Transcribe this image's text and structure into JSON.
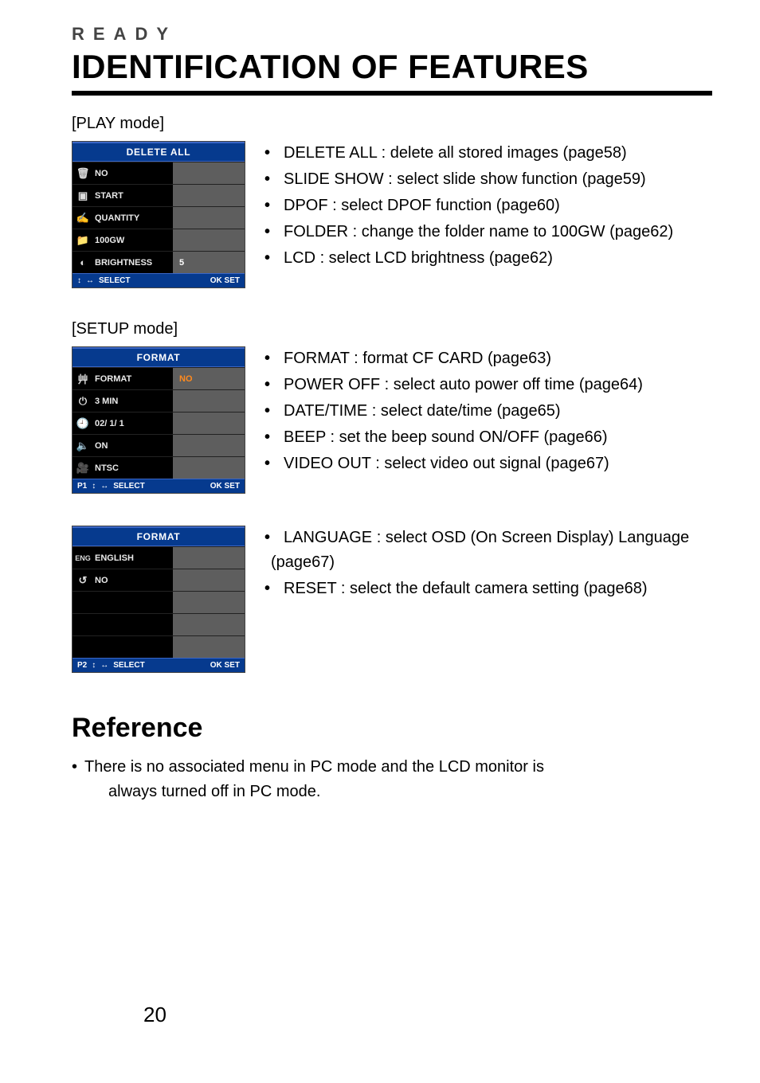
{
  "header": {
    "kicker": "READY",
    "title": "IDENTIFICATION OF FEATURES"
  },
  "play_mode": {
    "label": "[PLAY mode]",
    "osd": {
      "title": "DELETE  ALL",
      "rows": [
        {
          "icon": "trash-icon",
          "glyph": "🗑",
          "label": "NO",
          "value": ""
        },
        {
          "icon": "slideshow-icon",
          "glyph": "▣",
          "label": "START",
          "value": ""
        },
        {
          "icon": "dpof-icon",
          "glyph": "✍",
          "label": "QUANTITY",
          "value": ""
        },
        {
          "icon": "folder-icon",
          "glyph": "📁",
          "label": "100GW",
          "value": ""
        },
        {
          "icon": "brightness-icon",
          "glyph": "◐",
          "label": "BRIGHTNESS",
          "value": "5"
        }
      ],
      "footer_left": "SELECT",
      "footer_page": "",
      "footer_right": "OK  SET"
    },
    "desc": [
      "DELETE ALL : delete all stored images (page58)",
      "SLIDE SHOW : select slide show function (page59)",
      "DPOF : select DPOF function (page60)",
      "FOLDER : change the folder name to 100GW (page62)",
      "LCD : select LCD brightness (page62)"
    ]
  },
  "setup_mode": {
    "label": "[SETUP mode]",
    "osd1": {
      "title": "FORMAT",
      "rows": [
        {
          "icon": "format-icon",
          "glyph": "⾋",
          "label": "FORMAT",
          "value": "NO",
          "highlight": true
        },
        {
          "icon": "power-icon",
          "glyph": "⏻",
          "label": "3 MIN",
          "value": ""
        },
        {
          "icon": "clock-icon",
          "glyph": "🕘",
          "label": "02/ 1/ 1",
          "value": ""
        },
        {
          "icon": "speaker-icon",
          "glyph": "🔈",
          "label": "ON",
          "value": ""
        },
        {
          "icon": "video-icon",
          "glyph": "🎥",
          "label": "NTSC",
          "value": ""
        }
      ],
      "footer_page": "P1",
      "footer_left": "SELECT",
      "footer_right": "OK  SET"
    },
    "desc1": [
      "FORMAT : format CF CARD (page63)",
      "POWER OFF : select auto power off time (page64)",
      "DATE/TIME : select date/time (page65)",
      "BEEP : set the beep sound ON/OFF (page66)",
      "VIDEO OUT : select video out signal (page67)"
    ],
    "osd2": {
      "title": "FORMAT",
      "rows": [
        {
          "icon": "language-icon",
          "glyph": "ENG",
          "label": "ENGLISH",
          "value": ""
        },
        {
          "icon": "reset-icon",
          "glyph": "↺",
          "label": "NO",
          "value": ""
        },
        {
          "icon": "",
          "glyph": "",
          "label": "",
          "value": ""
        },
        {
          "icon": "",
          "glyph": "",
          "label": "",
          "value": ""
        },
        {
          "icon": "",
          "glyph": "",
          "label": "",
          "value": ""
        }
      ],
      "footer_page": "P2",
      "footer_left": "SELECT",
      "footer_right": "OK  SET"
    },
    "desc2": [
      "LANGUAGE : select OSD (On Screen Display) Language (page67)",
      "RESET : select the default camera setting (page68)"
    ]
  },
  "reference": {
    "title": "Reference",
    "bullet_prefix": "• ",
    "line1": "There is no associated menu in PC mode and the LCD monitor is",
    "line2": "always turned off in PC mode."
  },
  "page_number": "20",
  "glyphs": {
    "updown": "↕",
    "leftright": "↔"
  }
}
